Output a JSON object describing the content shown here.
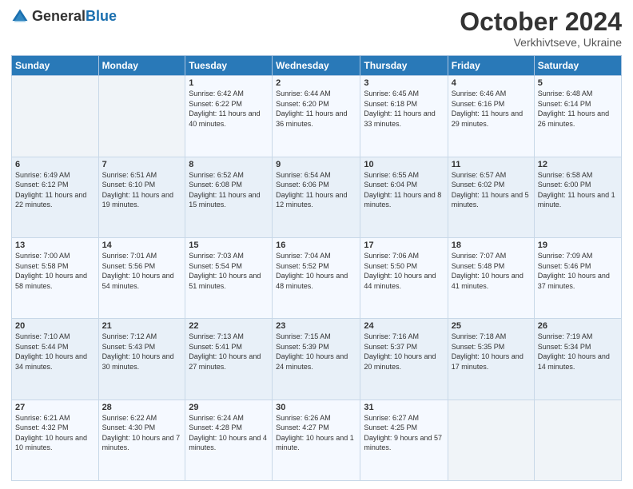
{
  "header": {
    "logo_general": "General",
    "logo_blue": "Blue",
    "month": "October 2024",
    "location": "Verkhivtseve, Ukraine"
  },
  "days_of_week": [
    "Sunday",
    "Monday",
    "Tuesday",
    "Wednesday",
    "Thursday",
    "Friday",
    "Saturday"
  ],
  "weeks": [
    [
      {
        "day": "",
        "sunrise": "",
        "sunset": "",
        "daylight": ""
      },
      {
        "day": "",
        "sunrise": "",
        "sunset": "",
        "daylight": ""
      },
      {
        "day": "1",
        "sunrise": "Sunrise: 6:42 AM",
        "sunset": "Sunset: 6:22 PM",
        "daylight": "Daylight: 11 hours and 40 minutes."
      },
      {
        "day": "2",
        "sunrise": "Sunrise: 6:44 AM",
        "sunset": "Sunset: 6:20 PM",
        "daylight": "Daylight: 11 hours and 36 minutes."
      },
      {
        "day": "3",
        "sunrise": "Sunrise: 6:45 AM",
        "sunset": "Sunset: 6:18 PM",
        "daylight": "Daylight: 11 hours and 33 minutes."
      },
      {
        "day": "4",
        "sunrise": "Sunrise: 6:46 AM",
        "sunset": "Sunset: 6:16 PM",
        "daylight": "Daylight: 11 hours and 29 minutes."
      },
      {
        "day": "5",
        "sunrise": "Sunrise: 6:48 AM",
        "sunset": "Sunset: 6:14 PM",
        "daylight": "Daylight: 11 hours and 26 minutes."
      }
    ],
    [
      {
        "day": "6",
        "sunrise": "Sunrise: 6:49 AM",
        "sunset": "Sunset: 6:12 PM",
        "daylight": "Daylight: 11 hours and 22 minutes."
      },
      {
        "day": "7",
        "sunrise": "Sunrise: 6:51 AM",
        "sunset": "Sunset: 6:10 PM",
        "daylight": "Daylight: 11 hours and 19 minutes."
      },
      {
        "day": "8",
        "sunrise": "Sunrise: 6:52 AM",
        "sunset": "Sunset: 6:08 PM",
        "daylight": "Daylight: 11 hours and 15 minutes."
      },
      {
        "day": "9",
        "sunrise": "Sunrise: 6:54 AM",
        "sunset": "Sunset: 6:06 PM",
        "daylight": "Daylight: 11 hours and 12 minutes."
      },
      {
        "day": "10",
        "sunrise": "Sunrise: 6:55 AM",
        "sunset": "Sunset: 6:04 PM",
        "daylight": "Daylight: 11 hours and 8 minutes."
      },
      {
        "day": "11",
        "sunrise": "Sunrise: 6:57 AM",
        "sunset": "Sunset: 6:02 PM",
        "daylight": "Daylight: 11 hours and 5 minutes."
      },
      {
        "day": "12",
        "sunrise": "Sunrise: 6:58 AM",
        "sunset": "Sunset: 6:00 PM",
        "daylight": "Daylight: 11 hours and 1 minute."
      }
    ],
    [
      {
        "day": "13",
        "sunrise": "Sunrise: 7:00 AM",
        "sunset": "Sunset: 5:58 PM",
        "daylight": "Daylight: 10 hours and 58 minutes."
      },
      {
        "day": "14",
        "sunrise": "Sunrise: 7:01 AM",
        "sunset": "Sunset: 5:56 PM",
        "daylight": "Daylight: 10 hours and 54 minutes."
      },
      {
        "day": "15",
        "sunrise": "Sunrise: 7:03 AM",
        "sunset": "Sunset: 5:54 PM",
        "daylight": "Daylight: 10 hours and 51 minutes."
      },
      {
        "day": "16",
        "sunrise": "Sunrise: 7:04 AM",
        "sunset": "Sunset: 5:52 PM",
        "daylight": "Daylight: 10 hours and 48 minutes."
      },
      {
        "day": "17",
        "sunrise": "Sunrise: 7:06 AM",
        "sunset": "Sunset: 5:50 PM",
        "daylight": "Daylight: 10 hours and 44 minutes."
      },
      {
        "day": "18",
        "sunrise": "Sunrise: 7:07 AM",
        "sunset": "Sunset: 5:48 PM",
        "daylight": "Daylight: 10 hours and 41 minutes."
      },
      {
        "day": "19",
        "sunrise": "Sunrise: 7:09 AM",
        "sunset": "Sunset: 5:46 PM",
        "daylight": "Daylight: 10 hours and 37 minutes."
      }
    ],
    [
      {
        "day": "20",
        "sunrise": "Sunrise: 7:10 AM",
        "sunset": "Sunset: 5:44 PM",
        "daylight": "Daylight: 10 hours and 34 minutes."
      },
      {
        "day": "21",
        "sunrise": "Sunrise: 7:12 AM",
        "sunset": "Sunset: 5:43 PM",
        "daylight": "Daylight: 10 hours and 30 minutes."
      },
      {
        "day": "22",
        "sunrise": "Sunrise: 7:13 AM",
        "sunset": "Sunset: 5:41 PM",
        "daylight": "Daylight: 10 hours and 27 minutes."
      },
      {
        "day": "23",
        "sunrise": "Sunrise: 7:15 AM",
        "sunset": "Sunset: 5:39 PM",
        "daylight": "Daylight: 10 hours and 24 minutes."
      },
      {
        "day": "24",
        "sunrise": "Sunrise: 7:16 AM",
        "sunset": "Sunset: 5:37 PM",
        "daylight": "Daylight: 10 hours and 20 minutes."
      },
      {
        "day": "25",
        "sunrise": "Sunrise: 7:18 AM",
        "sunset": "Sunset: 5:35 PM",
        "daylight": "Daylight: 10 hours and 17 minutes."
      },
      {
        "day": "26",
        "sunrise": "Sunrise: 7:19 AM",
        "sunset": "Sunset: 5:34 PM",
        "daylight": "Daylight: 10 hours and 14 minutes."
      }
    ],
    [
      {
        "day": "27",
        "sunrise": "Sunrise: 6:21 AM",
        "sunset": "Sunset: 4:32 PM",
        "daylight": "Daylight: 10 hours and 10 minutes."
      },
      {
        "day": "28",
        "sunrise": "Sunrise: 6:22 AM",
        "sunset": "Sunset: 4:30 PM",
        "daylight": "Daylight: 10 hours and 7 minutes."
      },
      {
        "day": "29",
        "sunrise": "Sunrise: 6:24 AM",
        "sunset": "Sunset: 4:28 PM",
        "daylight": "Daylight: 10 hours and 4 minutes."
      },
      {
        "day": "30",
        "sunrise": "Sunrise: 6:26 AM",
        "sunset": "Sunset: 4:27 PM",
        "daylight": "Daylight: 10 hours and 1 minute."
      },
      {
        "day": "31",
        "sunrise": "Sunrise: 6:27 AM",
        "sunset": "Sunset: 4:25 PM",
        "daylight": "Daylight: 9 hours and 57 minutes."
      },
      {
        "day": "",
        "sunrise": "",
        "sunset": "",
        "daylight": ""
      },
      {
        "day": "",
        "sunrise": "",
        "sunset": "",
        "daylight": ""
      }
    ]
  ]
}
